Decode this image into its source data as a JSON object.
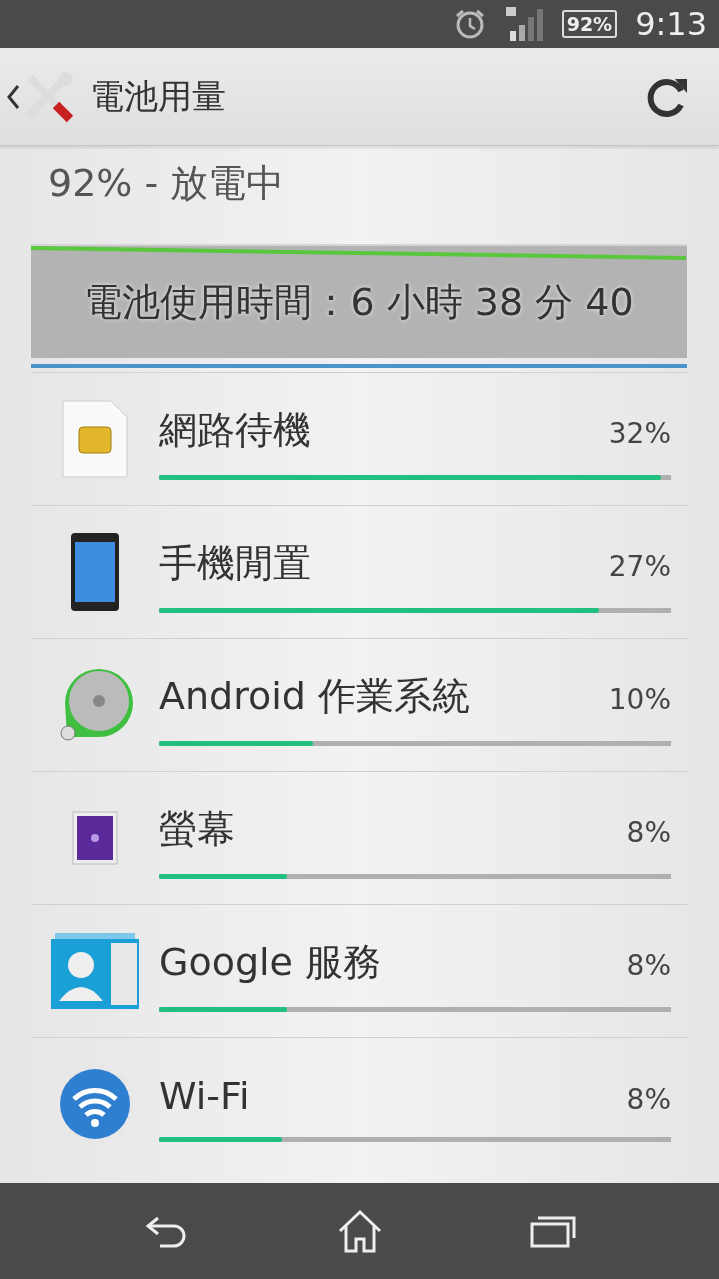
{
  "status_bar": {
    "battery": "92%",
    "time": "9:13"
  },
  "action_bar": {
    "title": "電池用量"
  },
  "summary": "92% - 放電中",
  "graph": {
    "usage_time": "電池使用時間：6 小時 38 分 40"
  },
  "items": [
    {
      "kind": "sim",
      "name": "網路待機",
      "percent": "32%",
      "level": 0.98
    },
    {
      "kind": "phone",
      "name": "手機閒置",
      "percent": "27%",
      "level": 0.86
    },
    {
      "kind": "android",
      "name": "Android 作業系統",
      "percent": "10%",
      "level": 0.3
    },
    {
      "kind": "screen",
      "name": "螢幕",
      "percent": "8%",
      "level": 0.25
    },
    {
      "kind": "contacts",
      "name": "Google 服務",
      "percent": "8%",
      "level": 0.25
    },
    {
      "kind": "wifi",
      "name": "Wi-Fi",
      "percent": "8%",
      "level": 0.24
    }
  ]
}
